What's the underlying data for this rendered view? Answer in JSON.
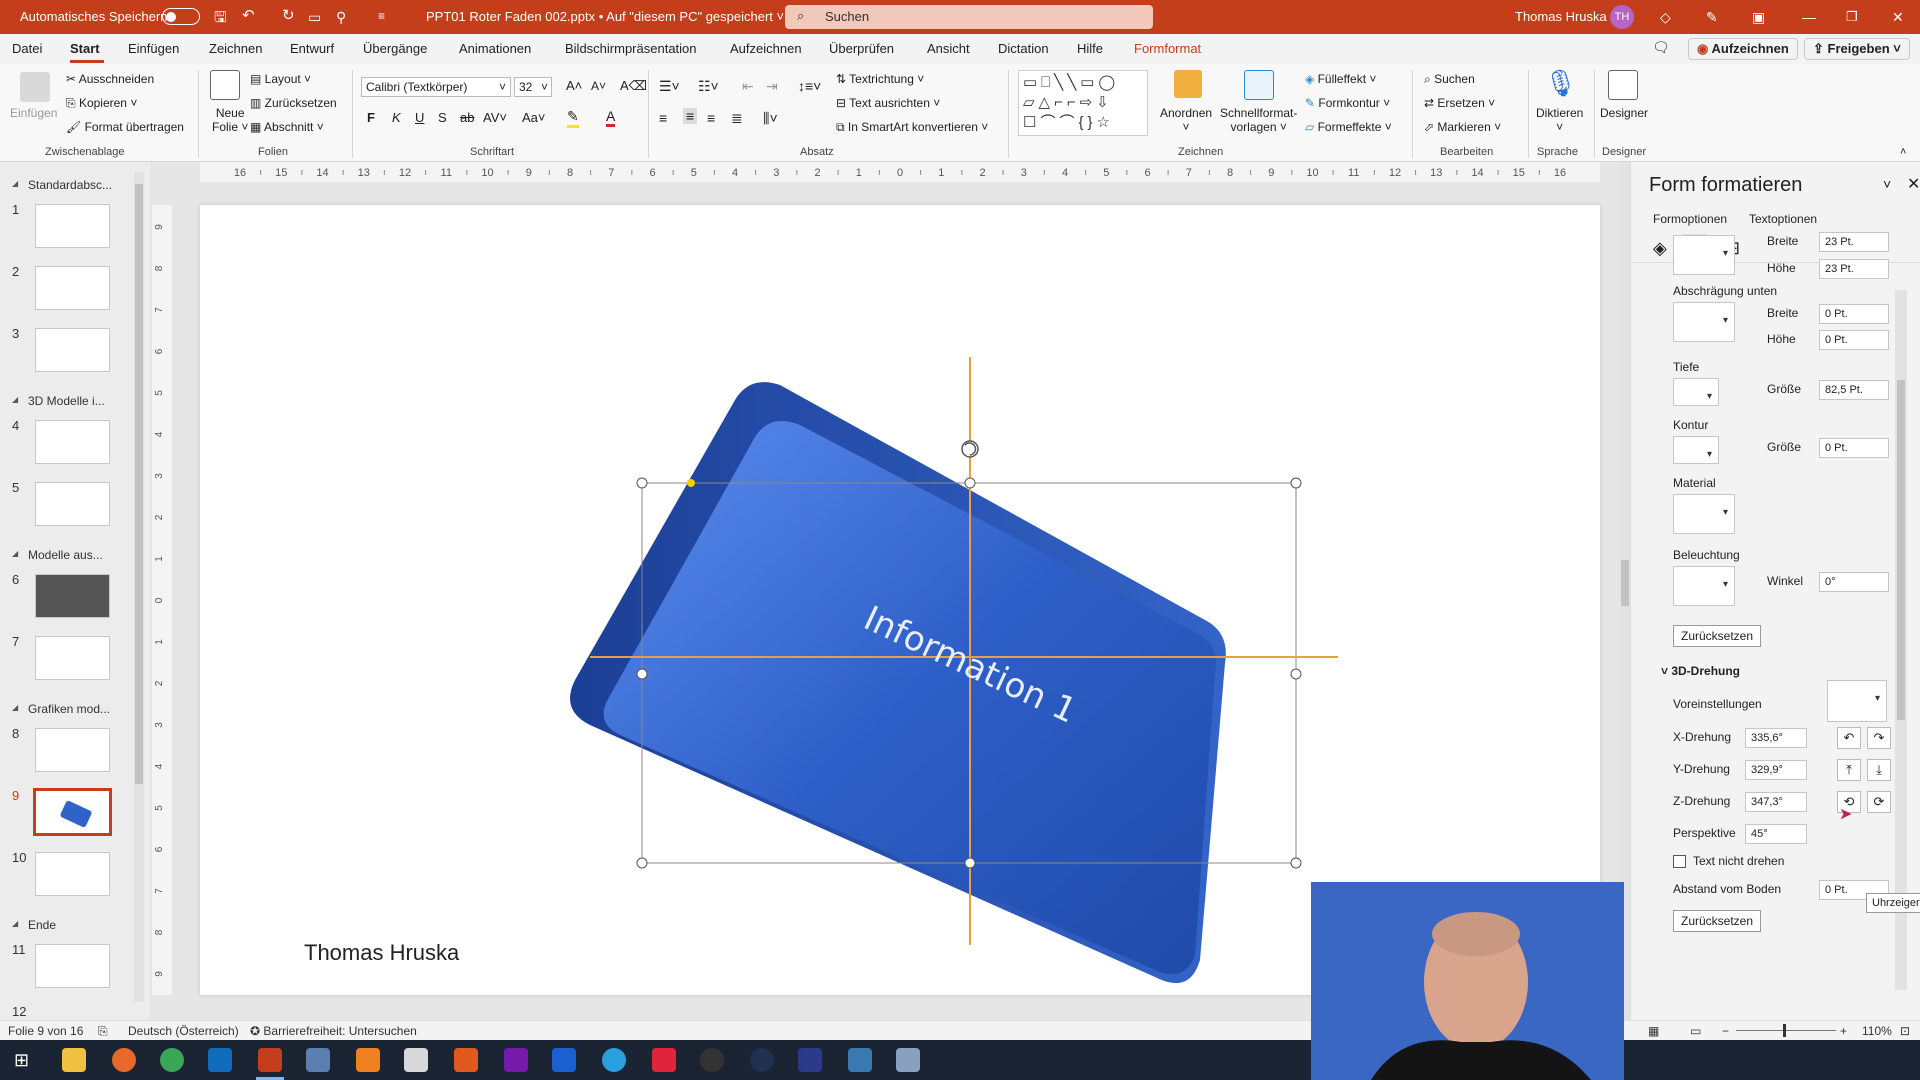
{
  "titlebar": {
    "autosave": "Automatisches Speichern",
    "filename": "PPT01 Roter Faden 002.pptx • Auf \"diesem PC\" gespeichert ˅",
    "search": "Suchen",
    "user": "Thomas Hruska",
    "initials": "TH"
  },
  "menu": [
    "Datei",
    "Start",
    "Einfügen",
    "Zeichnen",
    "Entwurf",
    "Übergänge",
    "Animationen",
    "Bildschirmpräsentation",
    "Aufzeichnen",
    "Überprüfen",
    "Ansicht",
    "Dictation",
    "Hilfe",
    "Formformat"
  ],
  "menu_right": {
    "record": "Aufzeichnen",
    "share": "Freigeben"
  },
  "ribbon": {
    "groups": [
      "Zwischenablage",
      "Folien",
      "Schriftart",
      "Absatz",
      "Zeichnen",
      "Bearbeiten",
      "Sprache",
      "Designer"
    ],
    "clipboard": {
      "paste": "Einfügen",
      "cut": "Ausschneiden",
      "copy": "Kopieren",
      "painter": "Format übertragen"
    },
    "slides": {
      "new1": "Neue",
      "new2": "Folie",
      "layout": "Layout",
      "reset": "Zurücksetzen",
      "section": "Abschnitt"
    },
    "font": {
      "family": "Calibri (Textkörper)",
      "size": "32",
      "bold": "F",
      "italic": "K",
      "underline": "U",
      "shadow": "S"
    },
    "paragraph": {
      "direction": "Textrichtung",
      "align": "Text ausrichten",
      "smartart": "In SmartArt konvertieren"
    },
    "drawing": {
      "arrange": "Anordnen",
      "quick1": "Schnellformat-",
      "quick2": "vorlagen",
      "fill": "Fülleffekt",
      "outline": "Formkontur",
      "effects": "Formeffekte"
    },
    "edit": {
      "find": "Suchen",
      "replace": "Ersetzen",
      "select": "Markieren"
    },
    "voice": {
      "dictate": "Diktieren"
    },
    "designer": {
      "label": "Designer"
    }
  },
  "thumbs": {
    "sections": [
      "Standardabsc...",
      "3D Modelle i...",
      "Modelle aus...",
      "Grafiken mod...",
      "Ende"
    ],
    "nums": [
      "1",
      "2",
      "3",
      "4",
      "5",
      "6",
      "7",
      "8",
      "9",
      "10",
      "11",
      "12"
    ]
  },
  "ruler": {
    "h_labels": [
      "16",
      "15",
      "14",
      "13",
      "12",
      "11",
      "10",
      "9",
      "8",
      "7",
      "6",
      "5",
      "4",
      "3",
      "2",
      "1",
      "0",
      "1",
      "2",
      "3",
      "4",
      "5",
      "6",
      "7",
      "8",
      "9",
      "10",
      "11",
      "12",
      "13",
      "14",
      "15",
      "16"
    ],
    "v_labels": [
      "9",
      "8",
      "7",
      "6",
      "5",
      "4",
      "3",
      "2",
      "1",
      "0",
      "1",
      "2",
      "3",
      "4",
      "5",
      "6",
      "7",
      "8",
      "9"
    ]
  },
  "slide": {
    "shape_text": "Information 1",
    "author": "Thomas Hruska"
  },
  "pane": {
    "title": "Form formatieren",
    "tabs": [
      "Formoptionen",
      "Textoptionen"
    ],
    "bevel_top": {
      "width_label": "Breite",
      "width": "23 Pt.",
      "height_label": "Höhe",
      "height": "23 Pt."
    },
    "bevel_bottom": {
      "label": "Abschrägung unten",
      "width_label": "Breite",
      "width": "0 Pt.",
      "height_label": "Höhe",
      "height": "0 Pt."
    },
    "depth": {
      "label": "Tiefe",
      "size_label": "Größe",
      "size": "82,5 Pt."
    },
    "contour": {
      "label": "Kontur",
      "size_label": "Größe",
      "size": "0 Pt."
    },
    "material": {
      "label": "Material"
    },
    "lighting": {
      "label": "Beleuchtung",
      "angle_label": "Winkel",
      "angle": "0°"
    },
    "reset": "Zurücksetzen",
    "rotation": {
      "title": "3D-Drehung",
      "presets_label": "Voreinstellungen",
      "x_label": "X-Drehung",
      "x": "335,6°",
      "y_label": "Y-Drehung",
      "y": "329,9°",
      "z_label": "Z-Drehung",
      "z": "347,3°",
      "perspective_label": "Perspektive",
      "perspective": "45°",
      "keep_text_flat": "Text nicht drehen",
      "distance_label": "Abstand vom Boden",
      "distance": "0 Pt."
    }
  },
  "tooltip": "Uhrzeigersinn",
  "status": {
    "slide": "Folie 9 von 16",
    "language": "Deutsch (Österreich)",
    "accessibility": "Barrierefreiheit: Untersuchen",
    "zoom": "110%"
  }
}
